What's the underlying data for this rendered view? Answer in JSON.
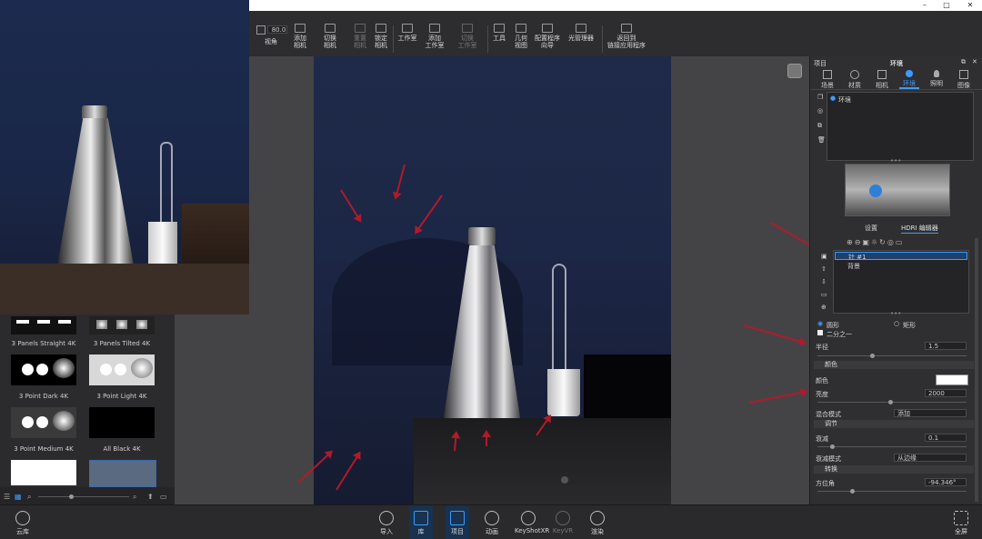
{
  "window": {
    "minimize": "–",
    "maximize": "□",
    "close": "✕"
  },
  "toolbar": {
    "fov_value": "80.0",
    "fov_label": "视角",
    "add_camera": [
      "添加",
      "相机"
    ],
    "switch_camera": [
      "切换",
      "相机"
    ],
    "reset_camera": [
      "重置",
      "相机"
    ],
    "lock_camera": [
      "锁定",
      "相机"
    ],
    "studio": "工作室",
    "add_studio": [
      "添加",
      "工作室"
    ],
    "switch_studio": [
      "切换",
      "工作室"
    ],
    "tools": "工具",
    "geometry_view": [
      "几何",
      "视图"
    ],
    "configurator_wizard": [
      "配置程序",
      "向导"
    ],
    "light_manager": "光管理器",
    "back_to_app": [
      "返回到",
      "链接应用程序"
    ]
  },
  "library": {
    "tiles": [
      {
        "label": "3 Panels Straight 4K"
      },
      {
        "label": "3 Panels Tilted 4K"
      },
      {
        "label": "3 Point Dark 4K"
      },
      {
        "label": "3 Point Light 4K"
      },
      {
        "label": "3 Point Medium 4K"
      },
      {
        "label": "All Black 4K"
      }
    ]
  },
  "panel": {
    "project_label": "项目",
    "env_title": "环境",
    "tabs": [
      {
        "label": "场景",
        "icon": "scene-icon"
      },
      {
        "label": "材质",
        "icon": "material-icon"
      },
      {
        "label": "相机",
        "icon": "camera-icon"
      },
      {
        "label": "环境",
        "icon": "environment-icon"
      },
      {
        "label": "照明",
        "icon": "lighting-icon"
      },
      {
        "label": "图像",
        "icon": "image-icon"
      }
    ],
    "env_item": "环境",
    "subtabs": {
      "settings": "设置",
      "hdri_editor": "HDRI 编辑器"
    },
    "pins": [
      {
        "label": "针 #1"
      },
      {
        "label": "背景"
      }
    ],
    "shape_circle": "圆形",
    "shape_rect": "矩形",
    "half": "二分之一",
    "radius_label": "半径",
    "radius_value": "1.5",
    "color_section": "颜色",
    "color_label": "颜色",
    "color_value": "#ffffff",
    "brightness_label": "亮度",
    "brightness_value": "2000",
    "blend_label": "混合模式",
    "blend_value": "添加",
    "adjust_section": "调节",
    "falloff_label": "衰减",
    "falloff_value": "0.1",
    "falloff_mode_label": "衰减模式",
    "falloff_mode_value": "从边缘",
    "transform_section": "转换",
    "azimuth_label": "方位角",
    "azimuth_value": "-94.346°"
  },
  "bottombar": {
    "cloud": "云库",
    "import": "导入",
    "library": "库",
    "project": "项目",
    "animation": "动画",
    "keyshotxr": "KeyShotXR",
    "keyvr": "KeyVR",
    "render": "渲染",
    "fullscreen": "全屏"
  },
  "colors": {
    "accent": "#2f7fd8",
    "arrow": "#b01a2a"
  }
}
